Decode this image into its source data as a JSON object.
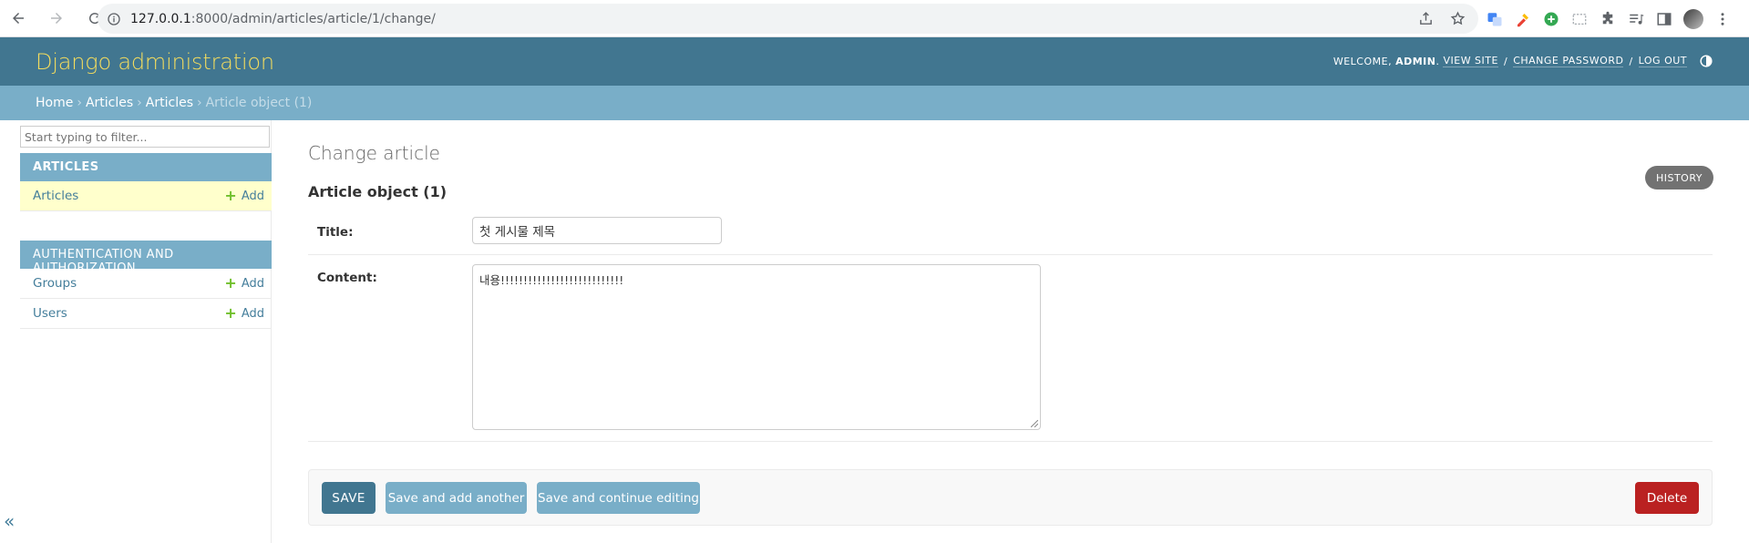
{
  "browser": {
    "url_host": "127.0.0.1",
    "url_path": ":8000/admin/articles/article/1/change/"
  },
  "header": {
    "brand": "Django administration",
    "welcome": "WELCOME,",
    "username": "ADMIN",
    "view_site": "VIEW SITE",
    "change_password": "CHANGE PASSWORD",
    "log_out": "LOG OUT",
    "separator": "/"
  },
  "breadcrumbs": {
    "home": "Home",
    "app": "Articles",
    "model": "Articles",
    "current": "Article object (1)",
    "arrow": "›"
  },
  "sidebar": {
    "filter_placeholder": "Start typing to filter...",
    "modules": [
      {
        "caption": "ARTICLES",
        "rows": [
          {
            "label": "Articles",
            "add": "Add"
          }
        ]
      },
      {
        "caption": "AUTHENTICATION AND AUTHORIZATION",
        "rows": [
          {
            "label": "Groups",
            "add": "Add"
          },
          {
            "label": "Users",
            "add": "Add"
          }
        ]
      }
    ],
    "collapse": "«"
  },
  "main": {
    "title": "Change article",
    "object_title": "Article object (1)",
    "history": "HISTORY",
    "fields": {
      "title_label": "Title:",
      "title_value": "첫 게시물 제목",
      "content_label": "Content:",
      "content_value": "내용!!!!!!!!!!!!!!!!!!!!!!!!!!!"
    },
    "actions": {
      "save": "SAVE",
      "save_add_another": "Save and add another",
      "save_continue": "Save and continue editing",
      "delete": "Delete"
    }
  },
  "colors": {
    "header_bg": "#417690",
    "brand": "#f5dd5d",
    "breadcrumb_bg": "#79aec8",
    "delete": "#ba2121",
    "add_plus": "#70bf2b",
    "selected_row": "#ffffcc"
  }
}
